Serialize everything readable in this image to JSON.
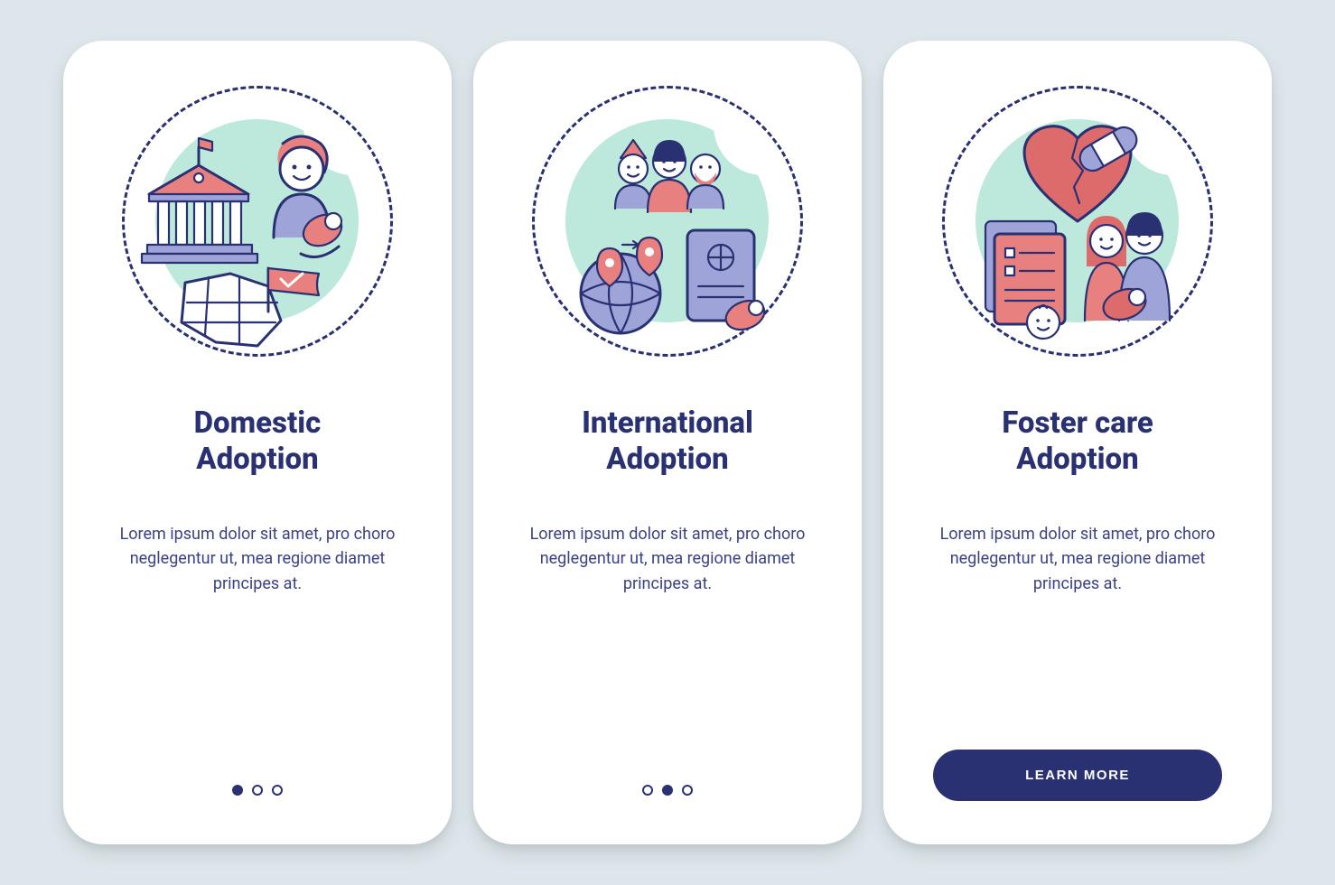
{
  "colors": {
    "background": "#dde7eb",
    "card": "#ffffff",
    "primary_text": "#2a3172",
    "body_text": "#3b4186",
    "accent_mint": "#bde9dc",
    "accent_blue": "#9fa4d8",
    "accent_red": "#e88080",
    "button_bg": "#2a3172",
    "button_text": "#ffffff"
  },
  "screens": [
    {
      "icon": "domestic-adoption-illustration",
      "title": "Domestic\nAdoption",
      "description": "Lorem ipsum dolor sit amet, pro choro neglegentur ut, mea regione diamet principes at.",
      "page_indicator": {
        "total": 3,
        "active_index": 0
      },
      "cta": null
    },
    {
      "icon": "international-adoption-illustration",
      "title": "International\nAdoption",
      "description": "Lorem ipsum dolor sit amet, pro choro neglegentur ut, mea regione diamet principes at.",
      "page_indicator": {
        "total": 3,
        "active_index": 1
      },
      "cta": null
    },
    {
      "icon": "foster-care-adoption-illustration",
      "title": "Foster care\nAdoption",
      "description": "Lorem ipsum dolor sit amet, pro choro neglegentur ut, mea regione diamet principes at.",
      "page_indicator": null,
      "cta": "LEARN MORE"
    }
  ]
}
